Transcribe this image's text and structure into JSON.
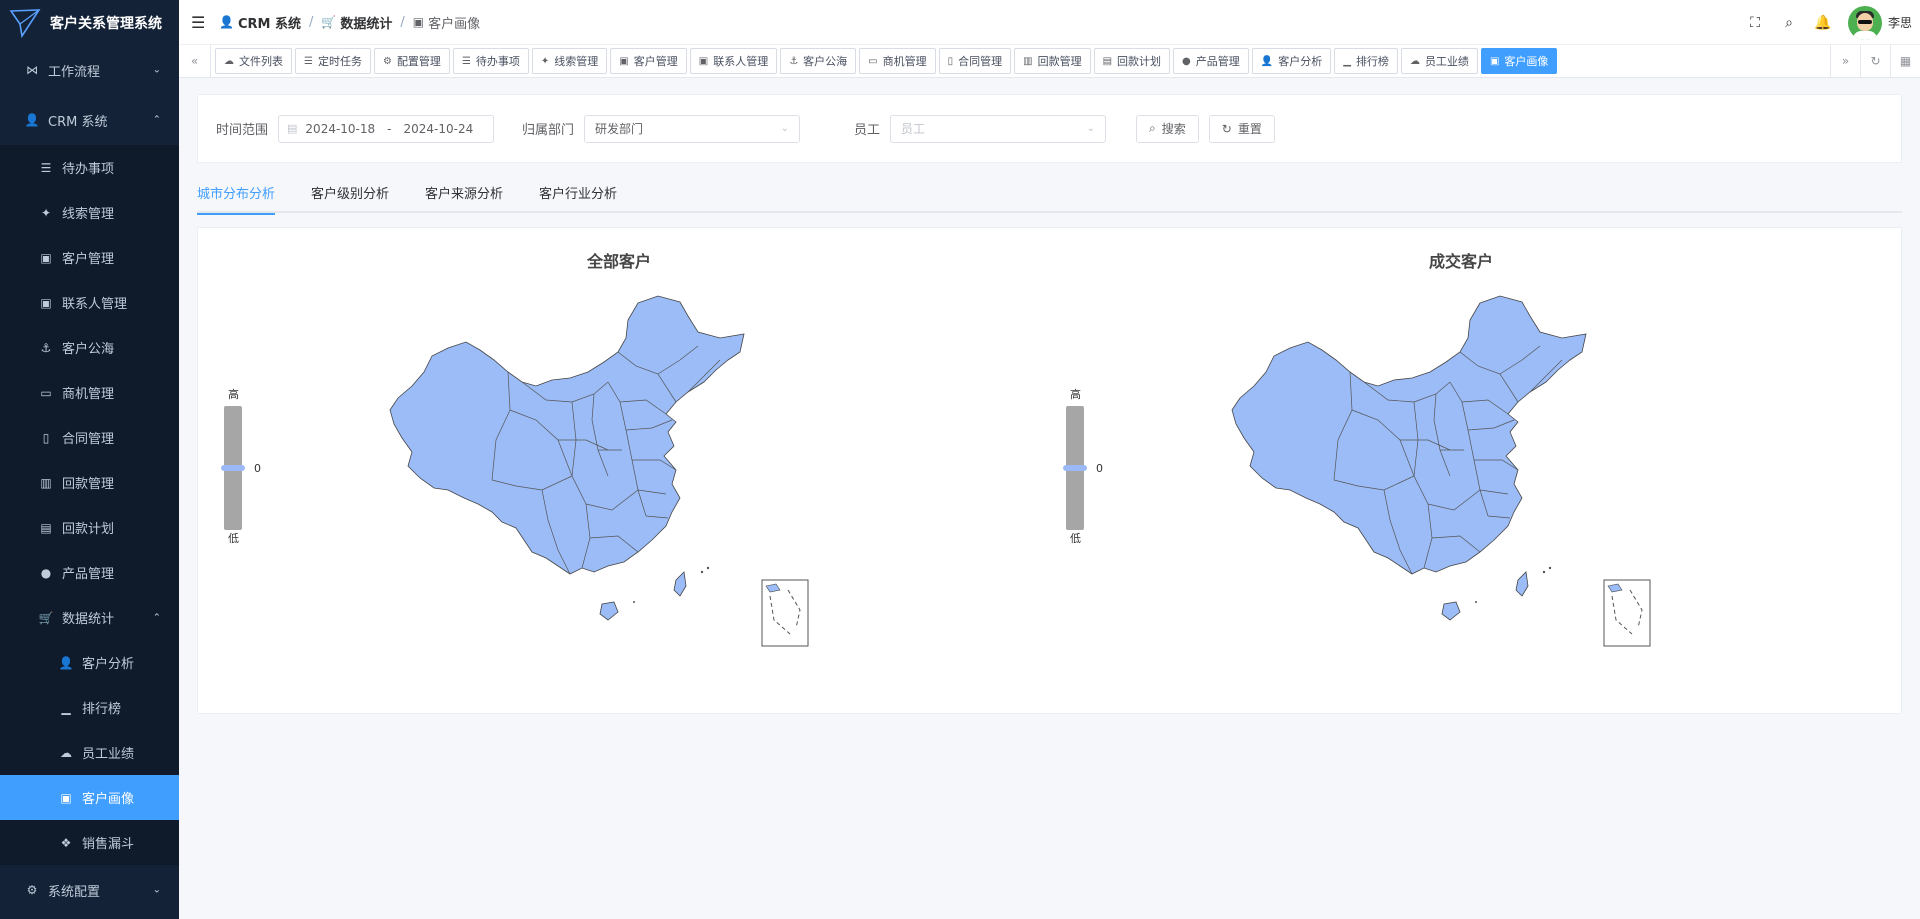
{
  "app": {
    "title": "客户关系管理系统"
  },
  "sidebar": {
    "items": [
      {
        "label": "工作流程",
        "icon": "workflow-icon",
        "level": "top",
        "arrow": "⌄"
      },
      {
        "label": "CRM 系统",
        "icon": "user-icon",
        "level": "top",
        "arrow": "⌃"
      },
      {
        "label": "待办事项",
        "icon": "list-icon",
        "level": "sub"
      },
      {
        "label": "线索管理",
        "icon": "clue-icon",
        "level": "sub"
      },
      {
        "label": "客户管理",
        "icon": "customer-icon",
        "level": "sub"
      },
      {
        "label": "联系人管理",
        "icon": "contact-icon",
        "level": "sub"
      },
      {
        "label": "客户公海",
        "icon": "sea-icon",
        "level": "sub"
      },
      {
        "label": "商机管理",
        "icon": "bus-icon",
        "level": "sub"
      },
      {
        "label": "合同管理",
        "icon": "book-icon",
        "level": "sub"
      },
      {
        "label": "回款管理",
        "icon": "money-icon",
        "level": "sub"
      },
      {
        "label": "回款计划",
        "icon": "cash-icon",
        "level": "sub"
      },
      {
        "label": "产品管理",
        "icon": "product-icon",
        "level": "sub"
      },
      {
        "label": "数据统计",
        "icon": "cart-icon",
        "level": "sub",
        "arrow": "⌃"
      },
      {
        "label": "客户分析",
        "icon": "user-icon",
        "level": "sub2"
      },
      {
        "label": "排行榜",
        "icon": "chart-icon",
        "level": "sub2"
      },
      {
        "label": "员工业绩",
        "icon": "cloud-icon",
        "level": "sub2"
      },
      {
        "label": "客户画像",
        "icon": "portrait-icon",
        "level": "sub2",
        "active": true
      },
      {
        "label": "销售漏斗",
        "icon": "funnel-icon",
        "level": "sub2"
      },
      {
        "label": "系统配置",
        "icon": "config-icon",
        "level": "top",
        "arrow": "⌄"
      }
    ]
  },
  "header": {
    "breadcrumb": [
      "CRM 系统",
      "数据统计",
      "客户画像"
    ],
    "user": "李思"
  },
  "tags": [
    "文件列表",
    "定时任务",
    "配置管理",
    "待办事项",
    "线索管理",
    "客户管理",
    "联系人管理",
    "客户公海",
    "商机管理",
    "合同管理",
    "回款管理",
    "回款计划",
    "产品管理",
    "客户分析",
    "排行榜",
    "员工业绩",
    "客户画像"
  ],
  "active_tag": "客户画像",
  "filters": {
    "time_label": "时间范围",
    "date_start": "2024-10-18",
    "date_sep": "-",
    "date_end": "2024-10-24",
    "dept_label": "归属部门",
    "dept_value": "研发部门",
    "employee_label": "员工",
    "employee_placeholder": "员工",
    "search_label": "搜索",
    "reset_label": "重置"
  },
  "tabs": [
    "城市分布分析",
    "客户级别分析",
    "客户来源分析",
    "客户行业分析"
  ],
  "active_tab": "城市分布分析",
  "chart_data": [
    {
      "type": "map",
      "title": "全部客户",
      "visual_map": {
        "high_label": "高",
        "low_label": "低",
        "value": 0,
        "min": 0,
        "max": 0
      },
      "fill_color": "#9bbcf7"
    },
    {
      "type": "map",
      "title": "成交客户",
      "visual_map": {
        "high_label": "高",
        "low_label": "低",
        "value": 0,
        "min": 0,
        "max": 0
      },
      "fill_color": "#9bbcf7"
    }
  ]
}
